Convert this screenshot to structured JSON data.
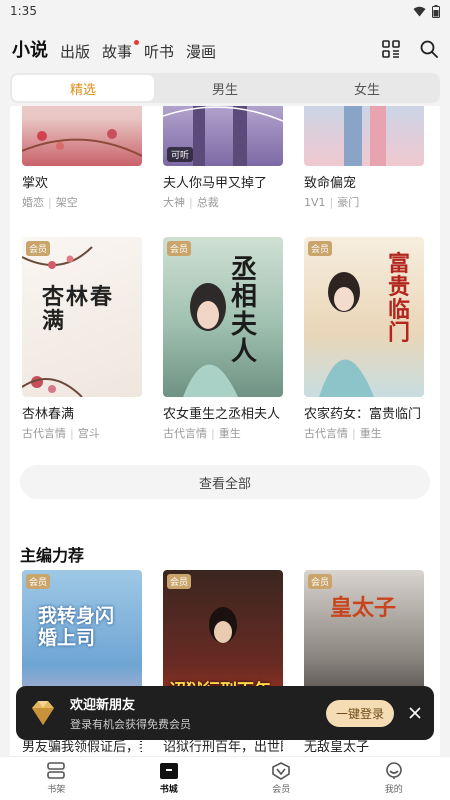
{
  "status": {
    "time": "1:35"
  },
  "nav": {
    "tabs": [
      {
        "label": "小说"
      },
      {
        "label": "出版"
      },
      {
        "label": "故事"
      },
      {
        "label": "听书"
      },
      {
        "label": "漫画"
      }
    ]
  },
  "segments": [
    {
      "label": "精选"
    },
    {
      "label": "男生"
    },
    {
      "label": "女生"
    }
  ],
  "accent_color": "#d9911b",
  "badges": {
    "vip": "会员",
    "listen": "可听"
  },
  "top_row": [
    {
      "title": "掌欢",
      "tags": [
        "婚恋",
        "架空"
      ]
    },
    {
      "title": "夫人你马甲又掉了",
      "tags": [
        "大神",
        "总裁"
      ]
    },
    {
      "title": "致命偏宠",
      "tags": [
        "1V1",
        "豪门"
      ]
    }
  ],
  "mid_row": [
    {
      "title": "杏林春满",
      "tags": [
        "古代言情",
        "宫斗"
      ],
      "cover_text": "杏林春满"
    },
    {
      "title": "农女重生之丞相夫人",
      "tags": [
        "古代言情",
        "重生"
      ],
      "cover_text": "丞相夫人"
    },
    {
      "title": "农家药女：富贵临门",
      "tags": [
        "古代言情",
        "重生"
      ],
      "cover_text": "富贵临门"
    }
  ],
  "see_all": "查看全部",
  "editor_section": {
    "title": "主编力荐",
    "books": [
      {
        "title": "男友骗我领假证后，我",
        "cover_text": "我转身闪婚上司"
      },
      {
        "title": "诏狱行刑百年，出世既",
        "cover_text": "诏狱行刑百年"
      },
      {
        "title": "无敌皇太子",
        "cover_text": "皇太子"
      }
    ]
  },
  "toast": {
    "title": "欢迎新朋友",
    "subtitle": "登录有机会获得免费会员",
    "button": "一键登录"
  },
  "bottom_nav": [
    {
      "label": "书架",
      "icon": "bookshelf-icon"
    },
    {
      "label": "书城",
      "icon": "bookstore-icon"
    },
    {
      "label": "会员",
      "icon": "vip-icon"
    },
    {
      "label": "我的",
      "icon": "profile-icon"
    }
  ]
}
